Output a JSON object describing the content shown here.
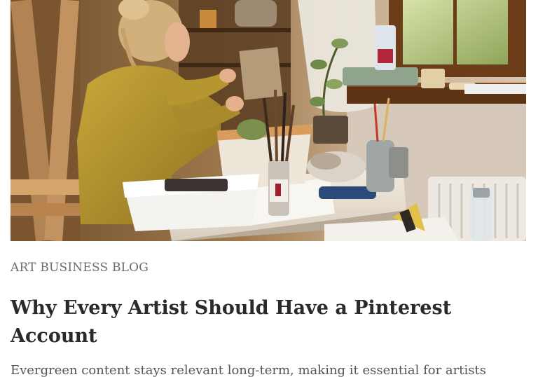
{
  "article": {
    "category": "ART BUSINESS BLOG",
    "title": "Why Every Artist Should Have a Pinterest Account",
    "excerpt": "Evergreen content stays relevant long-term, making it essential for artists"
  },
  "colors": {
    "category_text": "#6b6b6b",
    "title_text": "#2a2a2a",
    "excerpt_text": "#555555",
    "background": "#ffffff"
  }
}
